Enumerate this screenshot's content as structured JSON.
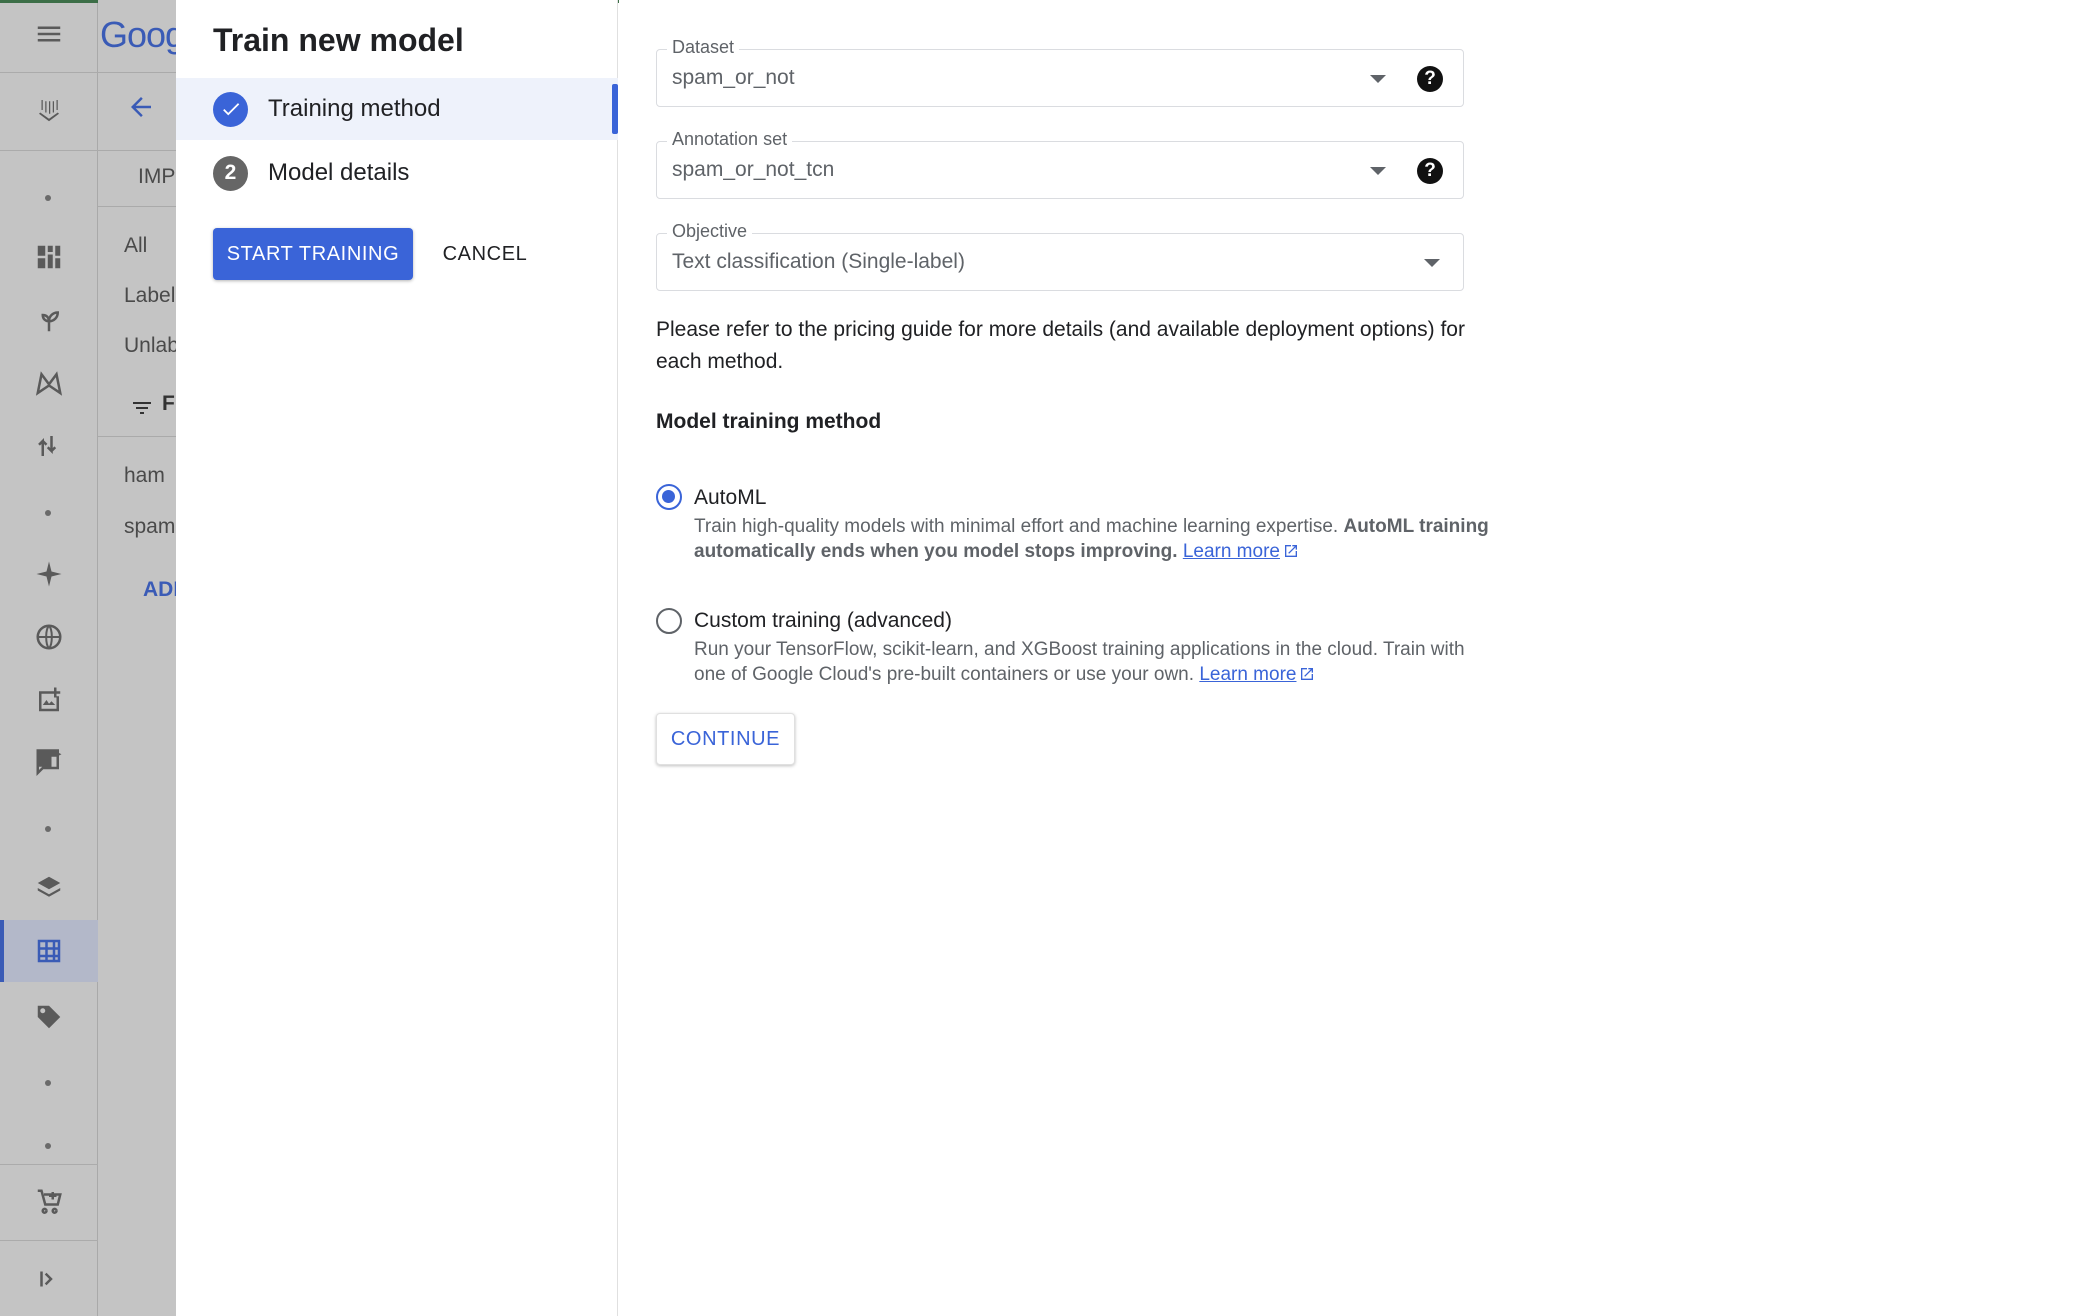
{
  "background": {
    "logo_text": "Goog",
    "import_tab": "IMP",
    "filter_all": "All",
    "filter_labeled": "Label",
    "filter_unlabeled": "Unlab",
    "filter_label": "F",
    "label_ham": "ham",
    "label_spam": "spam",
    "add_label": "ADD"
  },
  "stepper": {
    "title": "Train new model",
    "steps": [
      {
        "number": "1",
        "label": "Training method",
        "status": "done"
      },
      {
        "number": "2",
        "label": "Model details",
        "status": "pending"
      }
    ],
    "start_training_label": "START TRAINING",
    "cancel_label": "CANCEL"
  },
  "form": {
    "dataset": {
      "label": "Dataset",
      "value": "spam_or_not"
    },
    "annotation_set": {
      "label": "Annotation set",
      "value": "spam_or_not_tcn"
    },
    "objective": {
      "label": "Objective",
      "value": "Text classification (Single-label)"
    },
    "pricing_note": "Please refer to the pricing guide for more details (and available deployment options) for each method.",
    "method_title": "Model training method",
    "options": [
      {
        "title": "AutoML",
        "selected": true,
        "desc": "Train high-quality models with minimal effort and machine learning expertise.",
        "desc_bold": "AutoML training automatically ends when you model stops improving.",
        "link": "Learn more"
      },
      {
        "title": "Custom training (advanced)",
        "selected": false,
        "desc": "Run your TensorFlow, scikit-learn, and XGBoost training applications in the cloud. Train with one of Google Cloud's pre-built containers or use your own.",
        "link": "Learn more"
      }
    ],
    "continue_label": "CONTINUE"
  },
  "colors": {
    "accent": "#3a64d8",
    "scrim": "#c4c4c4"
  }
}
